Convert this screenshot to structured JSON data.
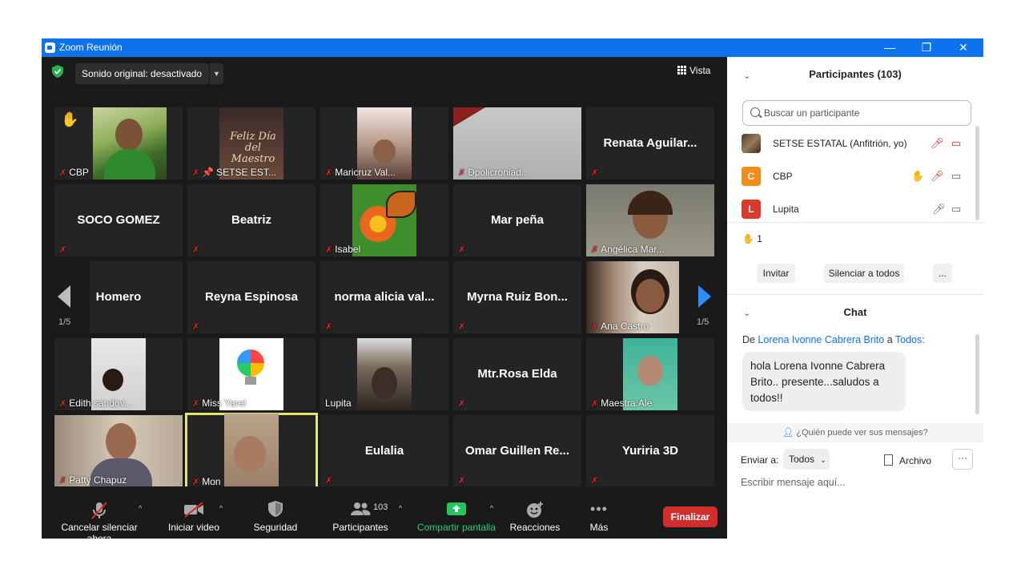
{
  "window": {
    "title": "Zoom Reunión",
    "min": "—",
    "restore": "❐",
    "close": "✕"
  },
  "meeting": {
    "audio_label": "Sonido original: desactivado",
    "view_label": "Vista",
    "tiles": [
      {
        "label": "CBP",
        "name": ""
      },
      {
        "label": "SETSE EST...",
        "name": ""
      },
      {
        "label": "Maricruz Val...",
        "name": ""
      },
      {
        "label": "Dpolicroniad...",
        "name": ""
      },
      {
        "label": "",
        "name": "Renata Aguilar..."
      },
      {
        "label": "",
        "name": "SOCO GOMEZ"
      },
      {
        "label": "",
        "name": "Beatriz"
      },
      {
        "label": "Isabel",
        "name": ""
      },
      {
        "label": "",
        "name": "Mar peña"
      },
      {
        "label": "Angélica Mar...",
        "name": ""
      },
      {
        "label": "",
        "name": "Homero"
      },
      {
        "label": "",
        "name": "Reyna Espinosa"
      },
      {
        "label": "",
        "name": "norma alicia val..."
      },
      {
        "label": "",
        "name": "Myrna Ruiz Bon..."
      },
      {
        "label": "Ana Castro",
        "name": ""
      },
      {
        "label": "Edith sandov...",
        "name": ""
      },
      {
        "label": "Miss Yarel",
        "name": ""
      },
      {
        "label": "Lupita",
        "name": ""
      },
      {
        "label": "",
        "name": "Mtr.Rosa Elda"
      },
      {
        "label": "Maestra:Ale",
        "name": ""
      },
      {
        "label": "Patty Chapuz",
        "name": ""
      },
      {
        "label": "Mon",
        "name": ""
      },
      {
        "label": "",
        "name": "Eulalia"
      },
      {
        "label": "",
        "name": "Omar Guillen Re..."
      },
      {
        "label": "",
        "name": "Yuriria 3D"
      }
    ],
    "page_left": "1/5",
    "page_right": "1/5",
    "poster_text": "Feliz Día del Maestro"
  },
  "toolbar": {
    "unmute": "Cancelar silenciar ahora",
    "video": "Iniciar video",
    "security": "Seguridad",
    "participants": "Participantes",
    "participants_count": "103",
    "share": "Compartir pantalla",
    "reactions": "Reacciones",
    "more": "Más",
    "end": "Finalizar"
  },
  "participants_panel": {
    "title": "Participantes (103)",
    "search_placeholder": "Buscar un participante",
    "list": [
      {
        "name": "SETSE ESTATAL (Anfitrión, yo)",
        "avatar": "",
        "color": "#6b5a3a"
      },
      {
        "name": "CBP",
        "avatar": "C",
        "color": "#f08c1a"
      },
      {
        "name": "Lupita",
        "avatar": "L",
        "color": "#d93a2b"
      }
    ],
    "raised_hands": "1",
    "invite": "Invitar",
    "mute_all": "Silenciar a todos",
    "more": "..."
  },
  "chat": {
    "title": "Chat",
    "from_prefix": "De",
    "sender": "Lorena Ivonne Cabrera Brito",
    "to_word": "a",
    "recipient": "Todos:",
    "message": "hola Lorena Ivonne Cabrera Brito.. presente...saludos a todos!!",
    "who_can_see": "¿Quién puede ver sus mensajes?",
    "send_to_label": "Enviar a:",
    "send_to_value": "Todos",
    "file_label": "Archivo",
    "more": "···",
    "compose_placeholder": "Escribir mensaje aquí..."
  },
  "colors": {
    "titlebar": "#0e72ed",
    "meeting_bg": "#1a1a1a",
    "tile_bg": "#242424",
    "end_button": "#d12d2d",
    "share_green": "#22c55e",
    "active_speaker": "#e0e76a",
    "link_blue": "#0e72ed"
  }
}
